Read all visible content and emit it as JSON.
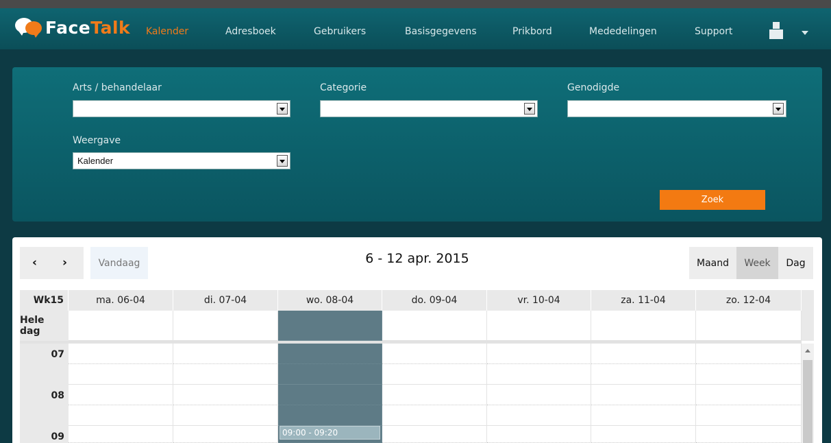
{
  "app": {
    "logo_face": "Face",
    "logo_talk": "Talk"
  },
  "nav": {
    "items": [
      "Kalender",
      "Adresboek",
      "Gebruikers",
      "Basisgegevens",
      "Prikbord",
      "Mededelingen",
      "Support"
    ],
    "active": "Kalender",
    "user_icon": "user-icon",
    "caret_icon": "caret-down-icon"
  },
  "filters": {
    "arts_label": "Arts / behandelaar",
    "arts_value": "",
    "categorie_label": "Categorie",
    "categorie_value": "",
    "genodigde_label": "Genodigde",
    "genodigde_value": "",
    "weergave_label": "Weergave",
    "weergave_value": "Kalender",
    "zoek_label": "Zoek"
  },
  "calendar": {
    "prev_label": "‹",
    "next_label": "›",
    "today_label": "Vandaag",
    "title": "6 - 12 apr. 2015",
    "views": [
      "Maand",
      "Week",
      "Dag"
    ],
    "active_view": "Week",
    "week_label": "Wk15",
    "days": [
      "ma. 06-04",
      "di. 07-04",
      "wo. 08-04",
      "do. 09-04",
      "vr. 10-04",
      "za. 11-04",
      "zo. 12-04"
    ],
    "today_column": "wo. 08-04",
    "allday_label": "Hele dag",
    "hours": [
      "07",
      "08",
      "09"
    ],
    "event_time": "09:00 - 09:20"
  },
  "colors": {
    "accent": "#f07b1a",
    "nav_bg": "#0b4e58",
    "panel_bg": "#0f6e78",
    "today_bg": "#5e7b86"
  }
}
